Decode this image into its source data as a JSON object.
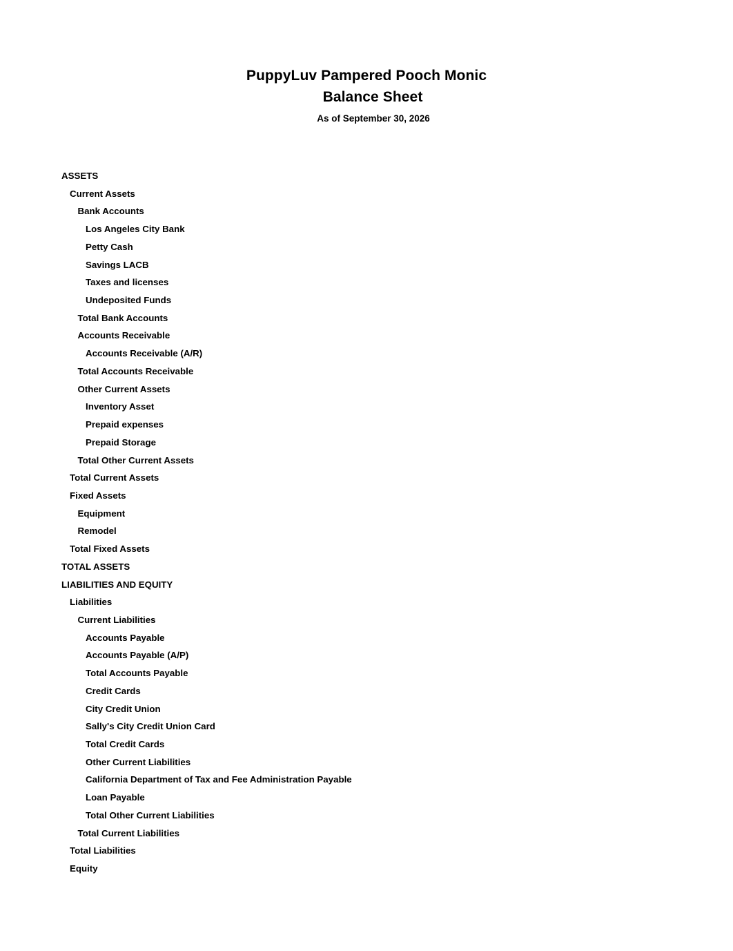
{
  "report": {
    "company_name": "PuppyLuv Pampered Pooch Monic",
    "report_title": "Balance Sheet",
    "as_of": "As of September 30, 2026"
  },
  "rows": [
    {
      "label": "ASSETS",
      "level": 0
    },
    {
      "label": "Current Assets",
      "level": 1
    },
    {
      "label": "Bank Accounts",
      "level": 2
    },
    {
      "label": "Los Angeles City Bank",
      "level": 3
    },
    {
      "label": "Petty Cash",
      "level": 3
    },
    {
      "label": "Savings LACB",
      "level": 3
    },
    {
      "label": "Taxes and licenses",
      "level": 3
    },
    {
      "label": "Undeposited Funds",
      "level": 3
    },
    {
      "label": "Total Bank Accounts",
      "level": 2
    },
    {
      "label": "Accounts Receivable",
      "level": 2
    },
    {
      "label": "Accounts Receivable (A/R)",
      "level": 3
    },
    {
      "label": "Total Accounts Receivable",
      "level": 2
    },
    {
      "label": "Other Current Assets",
      "level": 2
    },
    {
      "label": "Inventory Asset",
      "level": 3
    },
    {
      "label": "Prepaid expenses",
      "level": 3
    },
    {
      "label": "Prepaid Storage",
      "level": 3
    },
    {
      "label": "Total Other Current Assets",
      "level": 2
    },
    {
      "label": "Total Current Assets",
      "level": 1
    },
    {
      "label": "Fixed Assets",
      "level": 1
    },
    {
      "label": "Equipment",
      "level": 2
    },
    {
      "label": "Remodel",
      "level": 2
    },
    {
      "label": "Total Fixed Assets",
      "level": 1
    },
    {
      "label": "TOTAL ASSETS",
      "level": 0
    },
    {
      "label": "LIABILITIES AND EQUITY",
      "level": 0
    },
    {
      "label": "Liabilities",
      "level": 1
    },
    {
      "label": "Current Liabilities",
      "level": 2
    },
    {
      "label": "Accounts Payable",
      "level": 3
    },
    {
      "label": "Accounts Payable (A/P)",
      "level": 4
    },
    {
      "label": "Total Accounts Payable",
      "level": 3
    },
    {
      "label": "Credit Cards",
      "level": 3
    },
    {
      "label": "City Credit Union",
      "level": 4
    },
    {
      "label": "Sally's City Credit Union Card",
      "level": 4
    },
    {
      "label": "Total Credit Cards",
      "level": 3
    },
    {
      "label": "Other Current Liabilities",
      "level": 3
    },
    {
      "label": "California Department of Tax and Fee Administration Payable",
      "level": 4
    },
    {
      "label": "Loan Payable",
      "level": 4
    },
    {
      "label": "Total Other Current Liabilities",
      "level": 3
    },
    {
      "label": "Total Current Liabilities",
      "level": 2
    },
    {
      "label": "Total Liabilities",
      "level": 1
    },
    {
      "label": "Equity",
      "level": 1
    }
  ]
}
